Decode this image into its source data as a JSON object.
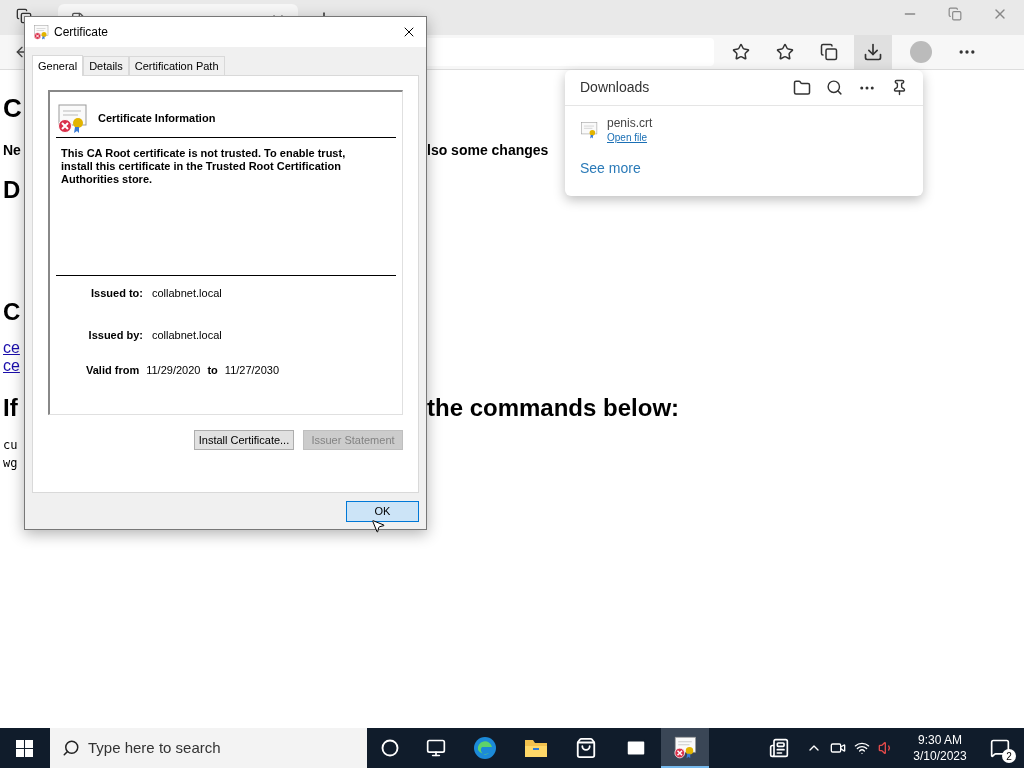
{
  "page": {
    "rows": [
      {
        "kind": "h1",
        "left": "C"
      },
      {
        "kind": "bold",
        "left": "Ne",
        "right": "lso some changes"
      },
      {
        "kind": "h2",
        "left": "D"
      },
      {
        "kind": "h2",
        "left": "C"
      },
      {
        "kind": "link",
        "left": "ce"
      },
      {
        "kind": "link",
        "left": "ce"
      },
      {
        "kind": "h2",
        "left": "If",
        "right": "the commands below:"
      },
      {
        "kind": "code",
        "left": "cu"
      },
      {
        "kind": "code",
        "left": "wg"
      }
    ]
  },
  "downloads": {
    "title": "Downloads",
    "items": [
      {
        "name": "penis.crt",
        "action": "Open file"
      }
    ],
    "see_more": "See more"
  },
  "dialog": {
    "title": "Certificate",
    "tabs": [
      {
        "label": "General",
        "selected": true
      },
      {
        "label": "Details",
        "selected": false
      },
      {
        "label": "Certification Path",
        "selected": false
      }
    ],
    "heading": "Certificate Information",
    "message": "This CA Root certificate is not trusted. To enable trust, install this certificate in the Trusted Root Certification Authorities store.",
    "fields": [
      {
        "label": "Issued to:",
        "value": "collabnet.local"
      },
      {
        "label": "Issued by:",
        "value": "collabnet.local"
      }
    ],
    "valid": {
      "label": "Valid from",
      "from": "11/29/2020",
      "to_label": "to",
      "to": "11/27/2030"
    },
    "buttons": [
      {
        "label": "Install Certificate...",
        "disabled": false
      },
      {
        "label": "Issuer Statement",
        "disabled": true
      }
    ],
    "ok": "OK"
  },
  "taskbar": {
    "search_placeholder": "Type here to search",
    "time": "9:30 AM",
    "date": "3/10/2023",
    "notification_count": "2"
  }
}
